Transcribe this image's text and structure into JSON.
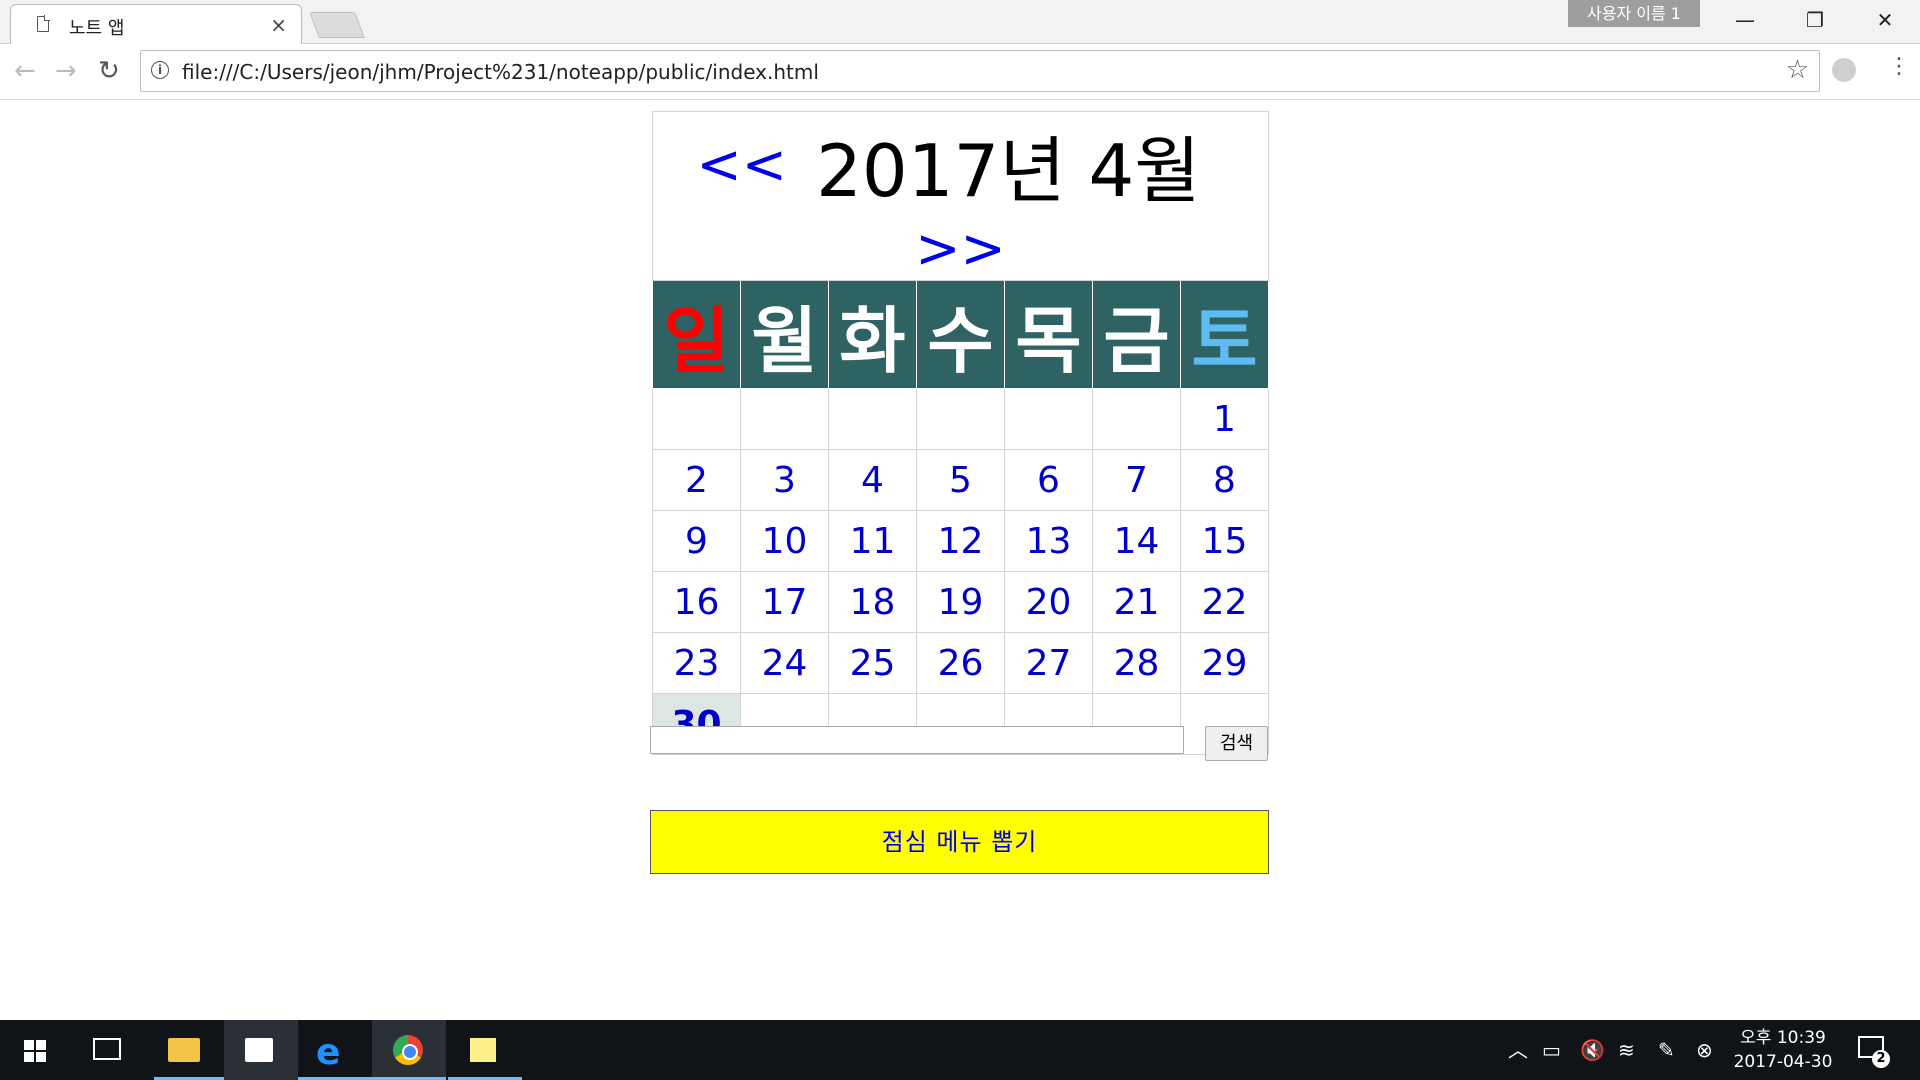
{
  "browser": {
    "tab_title": "노트 앱",
    "tab_close": "×",
    "profile_name": "사용자 이름 1",
    "url": "file:///C:/Users/jeon/jhm/Project%231/noteapp/public/index.html",
    "window_controls": {
      "minimize": "—",
      "maximize": "❐",
      "close": "✕"
    },
    "nav": {
      "back": "←",
      "forward": "→",
      "reload": "↻"
    },
    "star": "☆",
    "menu": "⋮",
    "info": "i"
  },
  "calendar": {
    "prev": "<<",
    "next": ">>",
    "title": "2017년 4월",
    "weekdays": [
      "일",
      "월",
      "화",
      "수",
      "목",
      "금",
      "토"
    ],
    "weeks": [
      [
        "",
        "",
        "",
        "",
        "",
        "",
        "1"
      ],
      [
        "2",
        "3",
        "4",
        "5",
        "6",
        "7",
        "8"
      ],
      [
        "9",
        "10",
        "11",
        "12",
        "13",
        "14",
        "15"
      ],
      [
        "16",
        "17",
        "18",
        "19",
        "20",
        "21",
        "22"
      ],
      [
        "23",
        "24",
        "25",
        "26",
        "27",
        "28",
        "29"
      ],
      [
        "30",
        "",
        "",
        "",
        "",
        "",
        ""
      ]
    ],
    "today": "30",
    "colors": {
      "header_bg": "#2f6262",
      "sunday": "#ff0000",
      "saturday": "#5ebcf0",
      "day_text": "#0000c8",
      "today_bg": "#dde6e3"
    }
  },
  "search": {
    "value": "",
    "button_label": "검색"
  },
  "lunch_button": {
    "label": "점심 메뉴 뽑기",
    "bg_color": "#ffff00"
  },
  "taskbar": {
    "clock_time": "오후 10:39",
    "clock_date": "2017-04-30",
    "notification_count": "2",
    "tray_icons": [
      "chevron-up-icon",
      "battery-icon",
      "volume-muted-icon",
      "wifi-icon",
      "pen-icon",
      "close-circle-icon"
    ],
    "pinned_apps": [
      "start-icon",
      "task-view-icon",
      "file-explorer-icon",
      "store-icon",
      "edge-icon",
      "chrome-icon",
      "sticky-notes-icon"
    ]
  }
}
